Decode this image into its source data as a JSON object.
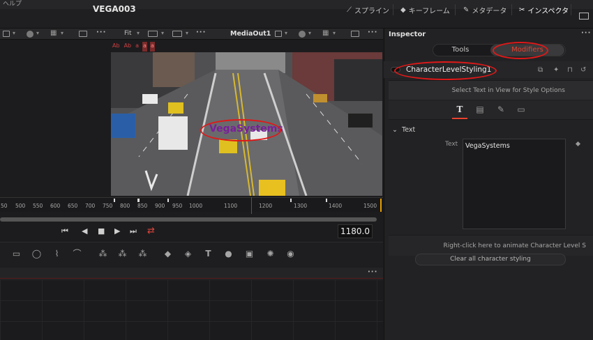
{
  "menu": {
    "help_label": "ヘルプ"
  },
  "project": {
    "title": "VEGA003"
  },
  "top_tabs": [
    {
      "label": "スプライン",
      "icon": "spline-icon"
    },
    {
      "label": "キーフレーム",
      "icon": "keyframe-icon"
    },
    {
      "label": "メタデータ",
      "icon": "metadata-icon"
    },
    {
      "label": "インスペクタ",
      "icon": "inspector-icon"
    }
  ],
  "viewer": {
    "fit_label": "Fit",
    "name": "MediaOut1",
    "overlay_tools": [
      "Ab",
      "Ab",
      "a",
      "a",
      "a"
    ],
    "overlay_text": "VegaSystems"
  },
  "ruler": {
    "labels": [
      "50",
      "500",
      "550",
      "600",
      "650",
      "700",
      "750",
      "800",
      "850",
      "900",
      "950",
      "1000",
      "1100",
      "1200",
      "1300",
      "1400",
      "1500"
    ]
  },
  "transport": {
    "timecode": "1180.0"
  },
  "inspector": {
    "title": "Inspector",
    "tab_tools": "Tools",
    "tab_modifiers": "Modifiers",
    "tool_name": "CharacterLevelStyling1",
    "select_hint": "Select Text in View for Style Options",
    "section": "Text",
    "text_label": "Text",
    "text_value": "VegaSystems",
    "right_click_hint": "Right-click here to animate Character Level S",
    "clear_button": "Clear all character styling"
  },
  "colors": {
    "accent": "#e9422f",
    "annotation": "#e01818",
    "playhead": "#d02020"
  }
}
